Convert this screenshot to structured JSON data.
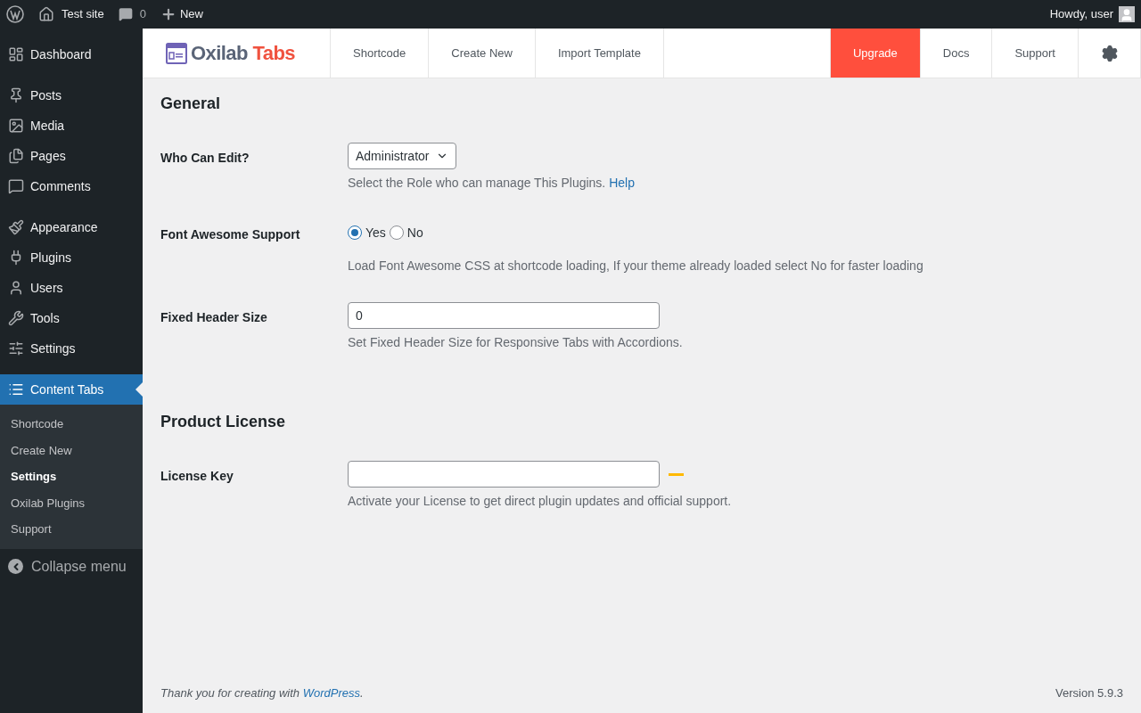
{
  "admin_bar": {
    "site": "Test site",
    "comments": "0",
    "new": "New",
    "greeting": "Howdy, user"
  },
  "sidebar": {
    "groups": [
      [
        {
          "label": "Dashboard",
          "selected": false
        }
      ],
      [
        {
          "label": "Posts",
          "selected": false
        },
        {
          "label": "Media",
          "selected": false
        },
        {
          "label": "Pages",
          "selected": false
        },
        {
          "label": "Comments",
          "selected": false
        }
      ],
      [
        {
          "label": "Appearance",
          "selected": false
        },
        {
          "label": "Plugins",
          "selected": false
        },
        {
          "label": "Users",
          "selected": false
        },
        {
          "label": "Tools",
          "selected": false
        },
        {
          "label": "Settings",
          "selected": false
        }
      ],
      [
        {
          "label": "Content Tabs",
          "selected": true
        }
      ]
    ],
    "submenu": [
      {
        "label": "Shortcode",
        "selected": false
      },
      {
        "label": "Create New",
        "selected": false
      },
      {
        "label": "Settings",
        "selected": true
      },
      {
        "label": "Oxilab Plugins",
        "selected": false
      },
      {
        "label": "Support",
        "selected": false
      }
    ],
    "collapse": "Collapse menu"
  },
  "plugin_header": {
    "logo_first": "Oxilab",
    "logo_second": "Tabs",
    "nav_left": [
      {
        "label": "Shortcode",
        "kind": "plain"
      },
      {
        "label": "Create New",
        "kind": "plain"
      },
      {
        "label": "Import Template",
        "kind": "plain"
      }
    ],
    "nav_right": [
      {
        "label": "Upgrade",
        "kind": "highlight"
      },
      {
        "label": "Docs",
        "kind": "plain"
      },
      {
        "label": "Support",
        "kind": "plain"
      }
    ]
  },
  "sections": [
    {
      "title": "General",
      "rows": [
        {
          "kind": "select",
          "label": "Who Can Edit?",
          "value": "Administrator",
          "help": "Select the Role who can manage This Plugins.",
          "link": "Help"
        },
        {
          "kind": "radio",
          "label": "Font Awesome Support",
          "options": [
            {
              "label": "Yes",
              "selected": true
            },
            {
              "label": "No",
              "selected": false
            }
          ],
          "help": "Load Font Awesome CSS at shortcode loading, If your theme already loaded select No for faster loading"
        },
        {
          "kind": "text",
          "label": "Fixed Header Size",
          "value": "0",
          "help": "Set Fixed Header Size for Responsive Tabs with Accordions."
        }
      ]
    },
    {
      "title": "Product License",
      "rows": [
        {
          "kind": "license",
          "label": "License Key",
          "value": "",
          "help": "Activate your License to get direct plugin updates and official support."
        }
      ]
    }
  ],
  "footer": {
    "text": "Thank you for creating with",
    "link": "WordPress",
    "after_link": ".",
    "version": "Version 5.9.3"
  }
}
